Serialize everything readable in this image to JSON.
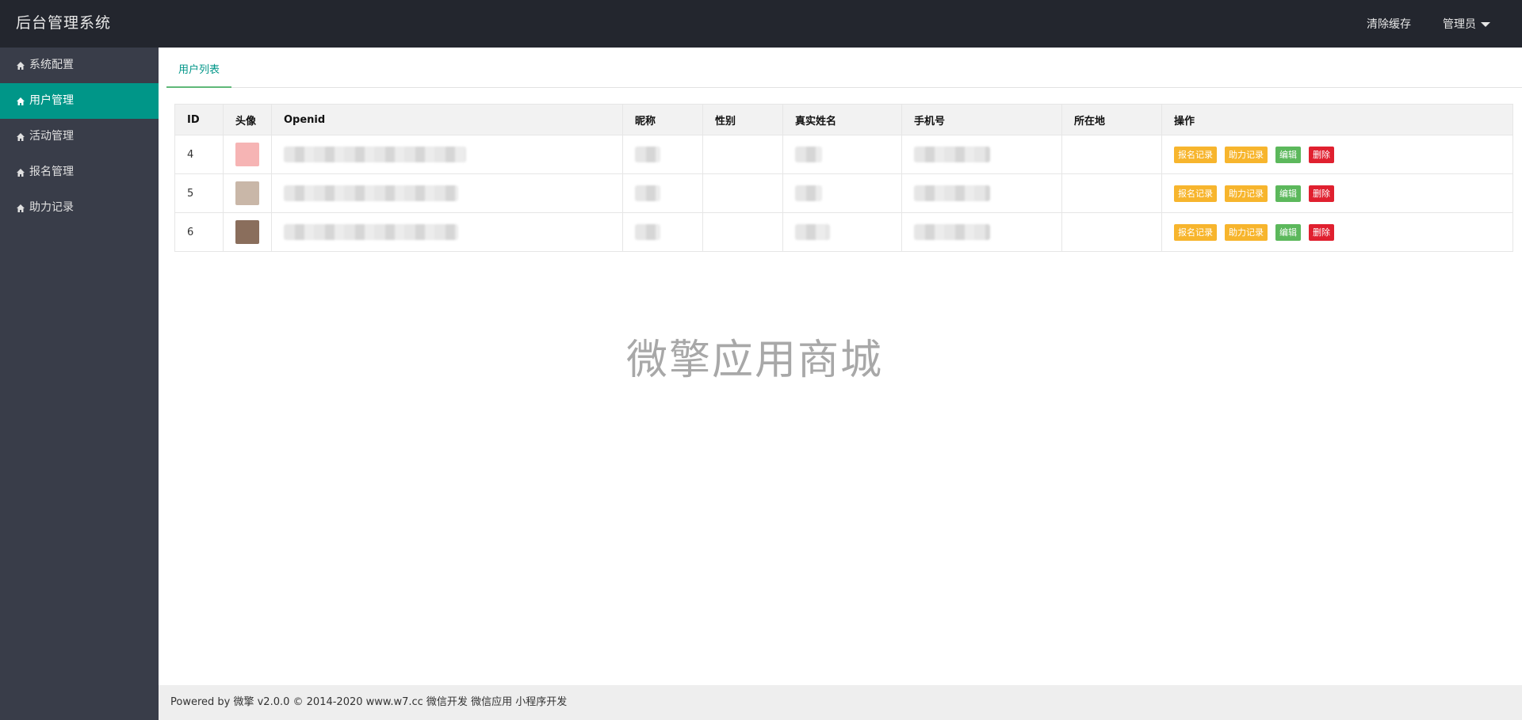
{
  "header": {
    "title": "后台管理系统",
    "clear_cache": "清除缓存",
    "admin": "管理员"
  },
  "sidebar": {
    "items": [
      {
        "label": "系统配置"
      },
      {
        "label": "用户管理"
      },
      {
        "label": "活动管理"
      },
      {
        "label": "报名管理"
      },
      {
        "label": "助力记录"
      }
    ]
  },
  "tabs": {
    "active": "用户列表"
  },
  "table": {
    "columns": [
      "ID",
      "头像",
      "Openid",
      "昵称",
      "性别",
      "真实姓名",
      "手机号",
      "所在地",
      "操作"
    ],
    "rows": [
      {
        "id": "4",
        "avatar_color": "#f6b4b4"
      },
      {
        "id": "5",
        "avatar_color": "#c9b7a8"
      },
      {
        "id": "6",
        "avatar_color": "#8a6e5c"
      }
    ],
    "actions": {
      "signup": "报名记录",
      "assist": "助力记录",
      "edit": "编辑",
      "delete": "删除"
    },
    "colors": {
      "signup": "#f7b52d",
      "assist": "#f7b52d",
      "edit": "#5cb85c",
      "delete": "#e0202f"
    }
  },
  "watermark": "微擎应用商城",
  "footer": "Powered by 微擎 v2.0.0 © 2014-2020 www.w7.cc 微信开发 微信应用 小程序开发"
}
